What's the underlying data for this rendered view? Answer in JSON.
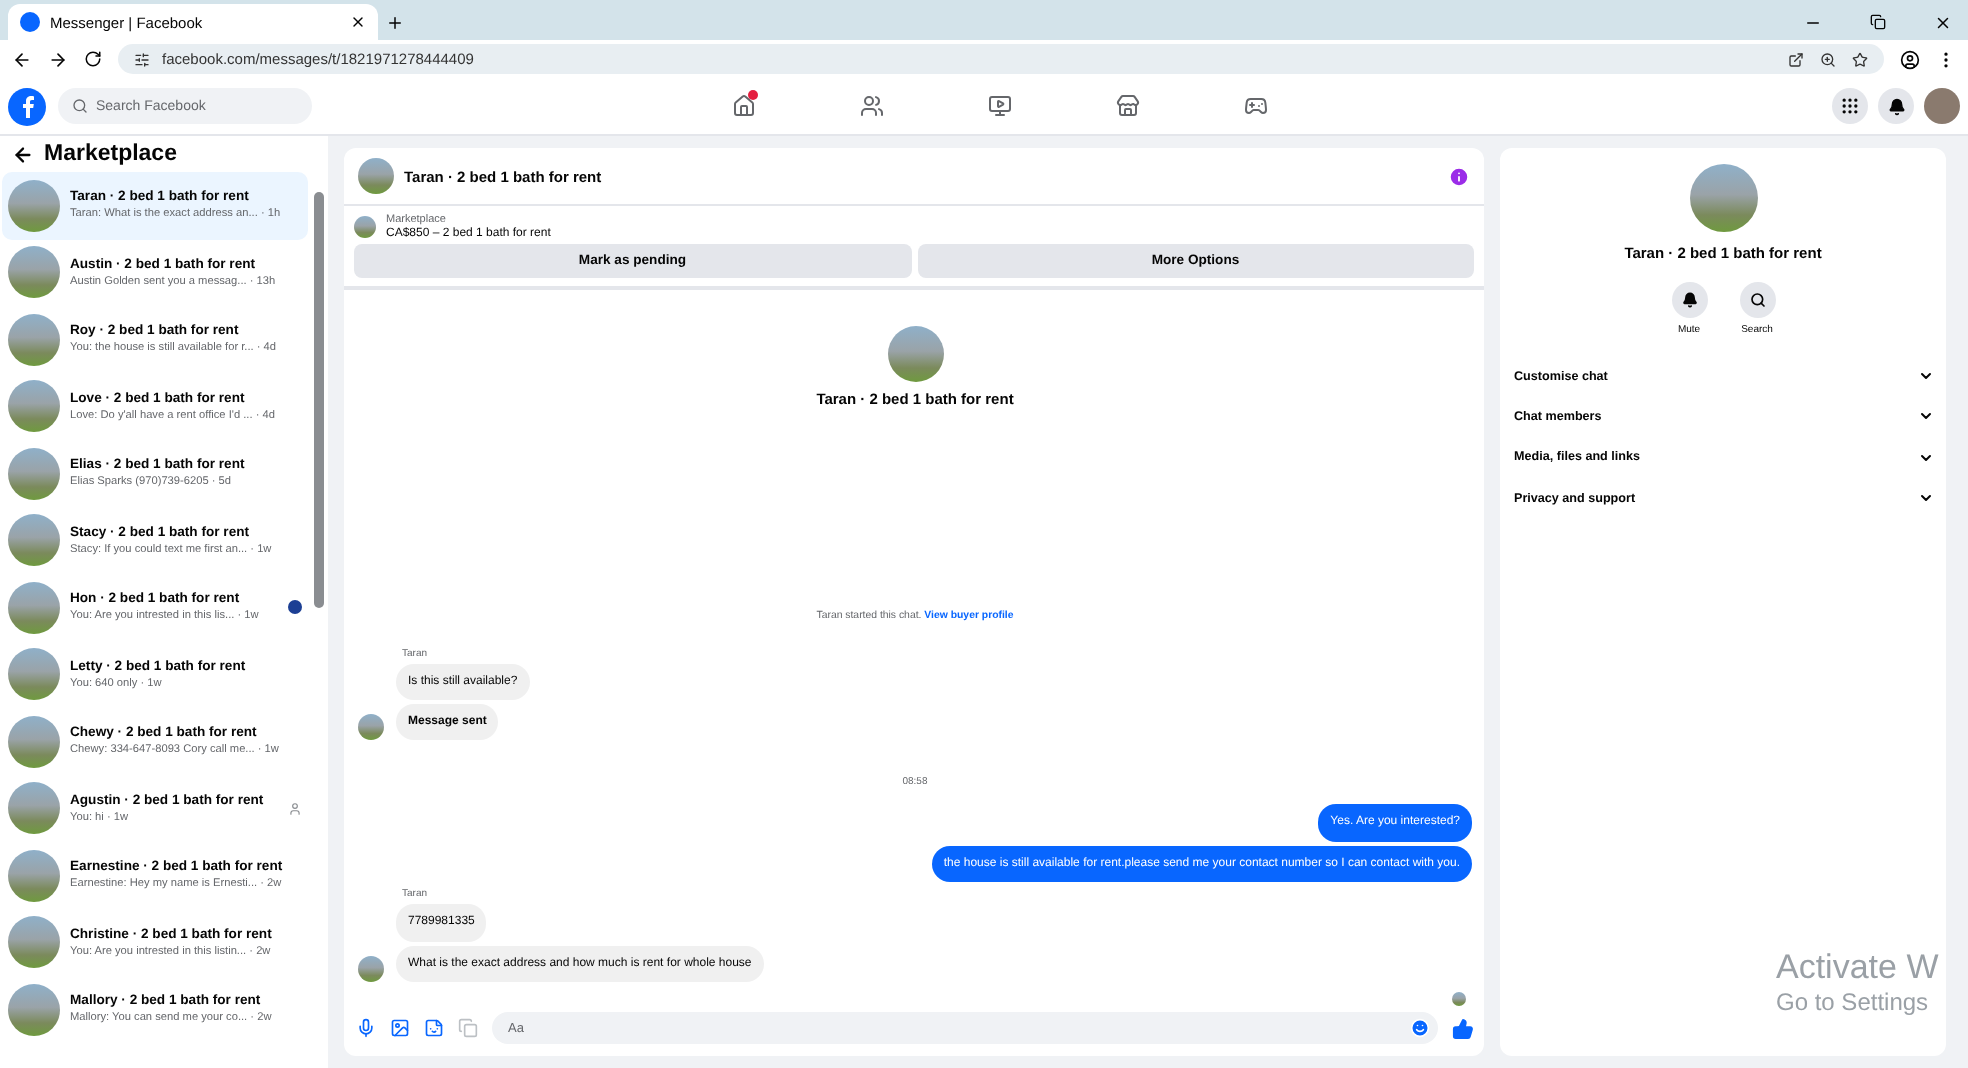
{
  "browser": {
    "tab_title": "Messenger | Facebook",
    "url": "facebook.com/messages/t/1821971278444409"
  },
  "topbar": {
    "search_placeholder": "Search Facebook",
    "nav": [
      {
        "kind": "home",
        "notification": true
      },
      {
        "kind": "friends",
        "notification": false
      },
      {
        "kind": "video",
        "notification": false
      },
      {
        "kind": "marketplace",
        "notification": false
      },
      {
        "kind": "gaming",
        "notification": false
      }
    ]
  },
  "sidebar": {
    "title": "Marketplace",
    "conversations": [
      {
        "name": "Taran · 2 bed 1 bath for rent",
        "preview": "Taran: What is the exact address an... · 1h",
        "selected": true,
        "seen": false,
        "delivered": false
      },
      {
        "name": "Austin · 2 bed 1 bath for rent",
        "preview": "Austin Golden sent you a messag... · 13h",
        "selected": false,
        "seen": false,
        "delivered": false
      },
      {
        "name": "Roy · 2 bed 1 bath for rent",
        "preview": "You: the house is still available for r... · 4d",
        "selected": false,
        "seen": false,
        "delivered": false
      },
      {
        "name": "Love · 2 bed 1 bath for rent",
        "preview": "Love: Do y'all have a rent office I'd ... · 4d",
        "selected": false,
        "seen": false,
        "delivered": false
      },
      {
        "name": "Elias · 2 bed 1 bath for rent",
        "preview": "Elias Sparks (970)739-6205 · 5d",
        "selected": false,
        "seen": false,
        "delivered": false
      },
      {
        "name": "Stacy · 2 bed 1 bath for rent",
        "preview": "Stacy: If you could text me first an... · 1w",
        "selected": false,
        "seen": false,
        "delivered": false
      },
      {
        "name": "Hon · 2 bed 1 bath for rent",
        "preview": "You: Are you intrested in this lis... · 1w",
        "selected": false,
        "seen": true,
        "delivered": false
      },
      {
        "name": "Letty · 2 bed 1 bath for rent",
        "preview": "You: 640 only · 1w",
        "selected": false,
        "seen": false,
        "delivered": false
      },
      {
        "name": "Chewy · 2 bed 1 bath for rent",
        "preview": "Chewy: 334-647-8093 Cory call me... · 1w",
        "selected": false,
        "seen": false,
        "delivered": false
      },
      {
        "name": "Agustin · 2 bed 1 bath for rent",
        "preview": "You: hi · 1w",
        "selected": false,
        "seen": false,
        "delivered": true
      },
      {
        "name": "Earnestine · 2 bed 1 bath for rent",
        "preview": "Earnestine: Hey my name is Ernesti... · 2w",
        "selected": false,
        "seen": false,
        "delivered": false
      },
      {
        "name": "Christine · 2 bed 1 bath for rent",
        "preview": "You: Are you intrested in this listin... · 2w",
        "selected": false,
        "seen": false,
        "delivered": false
      },
      {
        "name": "Mallory · 2 bed 1 bath for rent",
        "preview": "Mallory: You can send me your co... · 2w",
        "selected": false,
        "seen": false,
        "delivered": false
      }
    ]
  },
  "chat": {
    "title": "Taran · 2 bed 1 bath for rent",
    "listing": {
      "label": "Marketplace",
      "price_line": "CA$850 – 2 bed 1 bath for rent"
    },
    "actions": [
      "Mark as pending",
      "More Options"
    ],
    "intro_title": "Taran · 2 bed 1 bath for rent",
    "started_text": "Taran started this chat.",
    "started_link": "View buyer profile",
    "messages": [
      {
        "kind": "sender",
        "text": "Taran"
      },
      {
        "kind": "incoming",
        "text": "Is this still available?",
        "avatar": false
      },
      {
        "kind": "notice",
        "text": "Message sent",
        "avatar": true
      },
      {
        "kind": "timestamp",
        "text": "08:58"
      },
      {
        "kind": "outgoing",
        "text": "Yes. Are you interested?"
      },
      {
        "kind": "outgoing",
        "text": "the house is still available for rent.please send me your contact number so I can contact with you."
      },
      {
        "kind": "sender",
        "text": "Taran"
      },
      {
        "kind": "incoming",
        "text": "7789981335",
        "avatar": false
      },
      {
        "kind": "incoming",
        "text": "What is the exact address and how much is rent for whole house",
        "avatar": true
      }
    ],
    "composer_placeholder": "Aa"
  },
  "details": {
    "title": "Taran · 2 bed 1 bath for rent",
    "actions": [
      {
        "kind": "mute",
        "label": "Mute"
      },
      {
        "kind": "search",
        "label": "Search"
      }
    ],
    "sections": [
      {
        "label": "Customise chat",
        "expanded": false
      },
      {
        "label": "Chat members",
        "expanded": false
      },
      {
        "label": "Media, files and links",
        "expanded": false
      },
      {
        "label": "Privacy and support",
        "expanded": false
      }
    ]
  },
  "os_overlay": {
    "title": "Activate W",
    "subtitle": "Go to Settings"
  }
}
